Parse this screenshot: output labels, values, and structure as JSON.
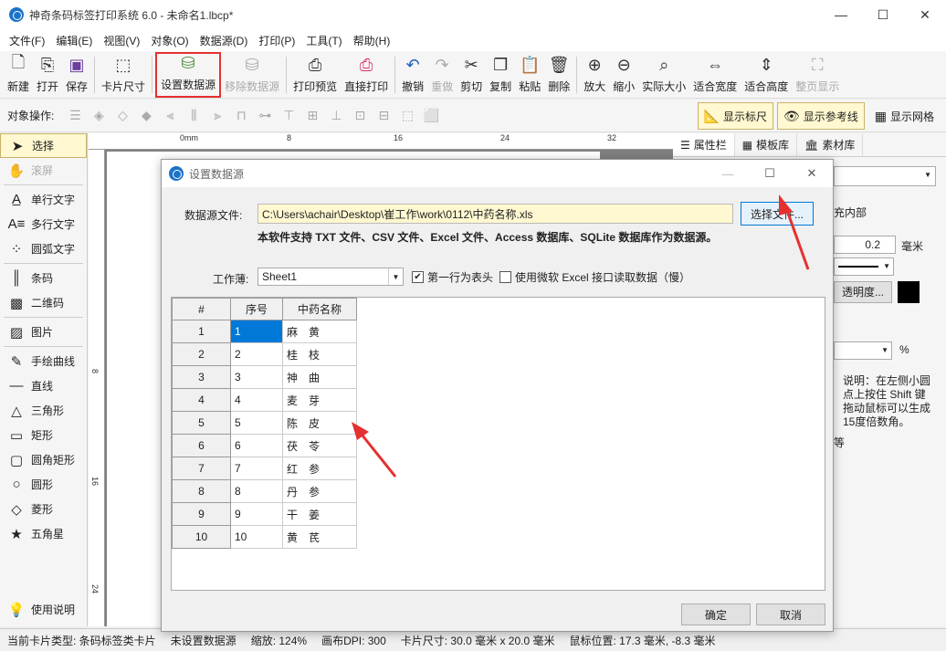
{
  "window": {
    "title": "神奇条码标签打印系统 6.0 - 未命名1.lbcp*",
    "minimize": "—",
    "maximize": "☐",
    "close": "✕"
  },
  "menu": [
    "文件(F)",
    "编辑(E)",
    "视图(V)",
    "对象(O)",
    "数据源(D)",
    "打印(P)",
    "工具(T)",
    "帮助(H)"
  ],
  "toolbar": {
    "new": "新建",
    "open": "打开",
    "save": "保存",
    "card_size": "卡片尺寸",
    "set_datasource": "设置数据源",
    "remove_datasource": "移除数据源",
    "print_preview": "打印预览",
    "direct_print": "直接打印",
    "undo": "撤销",
    "redo": "重做",
    "cut": "剪切",
    "copy": "复制",
    "paste": "粘贴",
    "delete": "删除",
    "zoom_in": "放大",
    "zoom_out": "缩小",
    "actual_size": "实际大小",
    "fit_width": "适合宽度",
    "fit_height": "适合高度",
    "full_page": "整页显示"
  },
  "ops": {
    "label": "对象操作:",
    "show_ruler": "显示标尺",
    "show_guides": "显示参考线",
    "show_grid": "显示网格"
  },
  "tools": {
    "select": "选择",
    "scroll": "滚屏",
    "single_text": "单行文字",
    "multi_text": "多行文字",
    "arc_text": "圆弧文字",
    "barcode": "条码",
    "qrcode": "二维码",
    "image": "图片",
    "freehand": "手绘曲线",
    "line": "直线",
    "triangle": "三角形",
    "rect": "矩形",
    "round_rect": "圆角矩形",
    "circle": "圆形",
    "diamond": "菱形",
    "star": "五角星",
    "help": "使用说明"
  },
  "ruler": {
    "h_ticks": [
      "0mm",
      "8",
      "16",
      "24",
      "32"
    ],
    "v_ticks": [
      "8",
      "16",
      "24"
    ]
  },
  "rightpanel": {
    "tabs": [
      "属性栏",
      "模板库",
      "素材库"
    ],
    "fill_inner": "充内部",
    "stroke_value": "0.2",
    "unit_mm": "毫米",
    "opacity": "透明度...",
    "percent": "%",
    "note": "说明：在左侧小圆点上按住 Shift 键拖动鼠标可以生成15度倍数角。",
    "fragment": "等"
  },
  "status": {
    "card_type": "当前卡片类型: 条码标签类卡片",
    "datasource": "未设置数据源",
    "zoom": "缩放: 124%",
    "dpi": "画布DPI: 300",
    "card_size": "卡片尺寸: 30.0 毫米 x 20.0 毫米",
    "mouse": "鼠标位置: 17.3 毫米, -8.3 毫米"
  },
  "dialog": {
    "title": "设置数据源",
    "file_label": "数据源文件:",
    "file_path": "C:\\Users\\achair\\Desktop\\崔工作\\work\\0112\\中药名称.xls",
    "choose_button": "选择文件...",
    "support_text": "本软件支持 TXT 文件、CSV 文件、Excel 文件、Access 数据库、SQLite 数据库作为数据源。",
    "sheet_label": "工作薄:",
    "sheet_value": "Sheet1",
    "first_row_header": "第一行为表头",
    "first_row_checked": "✔",
    "use_ms_excel": "使用微软 Excel 接口读取数据（慢）",
    "ok": "确定",
    "cancel": "取消",
    "grid": {
      "headers": [
        "#",
        "序号",
        "中药名称"
      ],
      "rows": [
        [
          "1",
          "1",
          "麻　黄"
        ],
        [
          "2",
          "2",
          "桂　枝"
        ],
        [
          "3",
          "3",
          "神　曲"
        ],
        [
          "4",
          "4",
          "麦　芽"
        ],
        [
          "5",
          "5",
          "陈　皮"
        ],
        [
          "6",
          "6",
          "茯　苓"
        ],
        [
          "7",
          "7",
          "红　参"
        ],
        [
          "8",
          "8",
          "丹　参"
        ],
        [
          "9",
          "9",
          "干　姜"
        ],
        [
          "10",
          "10",
          "黄　芪"
        ]
      ]
    }
  },
  "colors": {
    "highlight_red": "#e53030",
    "selection_blue": "#0078d7",
    "input_yellow": "#fff8d0"
  }
}
